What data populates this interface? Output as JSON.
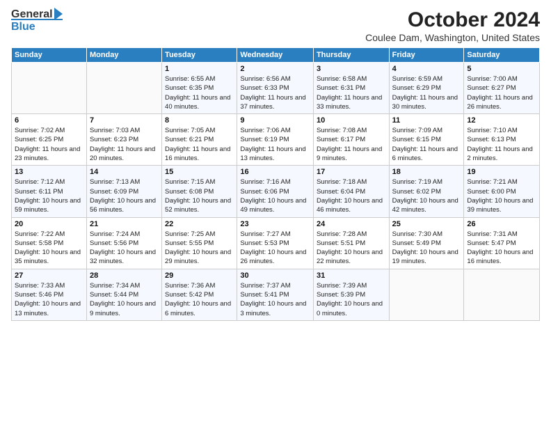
{
  "header": {
    "logo_top": "General",
    "logo_bottom": "Blue",
    "title": "October 2024",
    "subtitle": "Coulee Dam, Washington, United States"
  },
  "days_of_week": [
    "Sunday",
    "Monday",
    "Tuesday",
    "Wednesday",
    "Thursday",
    "Friday",
    "Saturday"
  ],
  "weeks": [
    [
      {
        "day": "",
        "info": ""
      },
      {
        "day": "",
        "info": ""
      },
      {
        "day": "1",
        "info": "Sunrise: 6:55 AM\nSunset: 6:35 PM\nDaylight: 11 hours\nand 40 minutes."
      },
      {
        "day": "2",
        "info": "Sunrise: 6:56 AM\nSunset: 6:33 PM\nDaylight: 11 hours\nand 37 minutes."
      },
      {
        "day": "3",
        "info": "Sunrise: 6:58 AM\nSunset: 6:31 PM\nDaylight: 11 hours\nand 33 minutes."
      },
      {
        "day": "4",
        "info": "Sunrise: 6:59 AM\nSunset: 6:29 PM\nDaylight: 11 hours\nand 30 minutes."
      },
      {
        "day": "5",
        "info": "Sunrise: 7:00 AM\nSunset: 6:27 PM\nDaylight: 11 hours\nand 26 minutes."
      }
    ],
    [
      {
        "day": "6",
        "info": "Sunrise: 7:02 AM\nSunset: 6:25 PM\nDaylight: 11 hours\nand 23 minutes."
      },
      {
        "day": "7",
        "info": "Sunrise: 7:03 AM\nSunset: 6:23 PM\nDaylight: 11 hours\nand 20 minutes."
      },
      {
        "day": "8",
        "info": "Sunrise: 7:05 AM\nSunset: 6:21 PM\nDaylight: 11 hours\nand 16 minutes."
      },
      {
        "day": "9",
        "info": "Sunrise: 7:06 AM\nSunset: 6:19 PM\nDaylight: 11 hours\nand 13 minutes."
      },
      {
        "day": "10",
        "info": "Sunrise: 7:08 AM\nSunset: 6:17 PM\nDaylight: 11 hours\nand 9 minutes."
      },
      {
        "day": "11",
        "info": "Sunrise: 7:09 AM\nSunset: 6:15 PM\nDaylight: 11 hours\nand 6 minutes."
      },
      {
        "day": "12",
        "info": "Sunrise: 7:10 AM\nSunset: 6:13 PM\nDaylight: 11 hours\nand 2 minutes."
      }
    ],
    [
      {
        "day": "13",
        "info": "Sunrise: 7:12 AM\nSunset: 6:11 PM\nDaylight: 10 hours\nand 59 minutes."
      },
      {
        "day": "14",
        "info": "Sunrise: 7:13 AM\nSunset: 6:09 PM\nDaylight: 10 hours\nand 56 minutes."
      },
      {
        "day": "15",
        "info": "Sunrise: 7:15 AM\nSunset: 6:08 PM\nDaylight: 10 hours\nand 52 minutes."
      },
      {
        "day": "16",
        "info": "Sunrise: 7:16 AM\nSunset: 6:06 PM\nDaylight: 10 hours\nand 49 minutes."
      },
      {
        "day": "17",
        "info": "Sunrise: 7:18 AM\nSunset: 6:04 PM\nDaylight: 10 hours\nand 46 minutes."
      },
      {
        "day": "18",
        "info": "Sunrise: 7:19 AM\nSunset: 6:02 PM\nDaylight: 10 hours\nand 42 minutes."
      },
      {
        "day": "19",
        "info": "Sunrise: 7:21 AM\nSunset: 6:00 PM\nDaylight: 10 hours\nand 39 minutes."
      }
    ],
    [
      {
        "day": "20",
        "info": "Sunrise: 7:22 AM\nSunset: 5:58 PM\nDaylight: 10 hours\nand 35 minutes."
      },
      {
        "day": "21",
        "info": "Sunrise: 7:24 AM\nSunset: 5:56 PM\nDaylight: 10 hours\nand 32 minutes."
      },
      {
        "day": "22",
        "info": "Sunrise: 7:25 AM\nSunset: 5:55 PM\nDaylight: 10 hours\nand 29 minutes."
      },
      {
        "day": "23",
        "info": "Sunrise: 7:27 AM\nSunset: 5:53 PM\nDaylight: 10 hours\nand 26 minutes."
      },
      {
        "day": "24",
        "info": "Sunrise: 7:28 AM\nSunset: 5:51 PM\nDaylight: 10 hours\nand 22 minutes."
      },
      {
        "day": "25",
        "info": "Sunrise: 7:30 AM\nSunset: 5:49 PM\nDaylight: 10 hours\nand 19 minutes."
      },
      {
        "day": "26",
        "info": "Sunrise: 7:31 AM\nSunset: 5:47 PM\nDaylight: 10 hours\nand 16 minutes."
      }
    ],
    [
      {
        "day": "27",
        "info": "Sunrise: 7:33 AM\nSunset: 5:46 PM\nDaylight: 10 hours\nand 13 minutes."
      },
      {
        "day": "28",
        "info": "Sunrise: 7:34 AM\nSunset: 5:44 PM\nDaylight: 10 hours\nand 9 minutes."
      },
      {
        "day": "29",
        "info": "Sunrise: 7:36 AM\nSunset: 5:42 PM\nDaylight: 10 hours\nand 6 minutes."
      },
      {
        "day": "30",
        "info": "Sunrise: 7:37 AM\nSunset: 5:41 PM\nDaylight: 10 hours\nand 3 minutes."
      },
      {
        "day": "31",
        "info": "Sunrise: 7:39 AM\nSunset: 5:39 PM\nDaylight: 10 hours\nand 0 minutes."
      },
      {
        "day": "",
        "info": ""
      },
      {
        "day": "",
        "info": ""
      }
    ]
  ]
}
